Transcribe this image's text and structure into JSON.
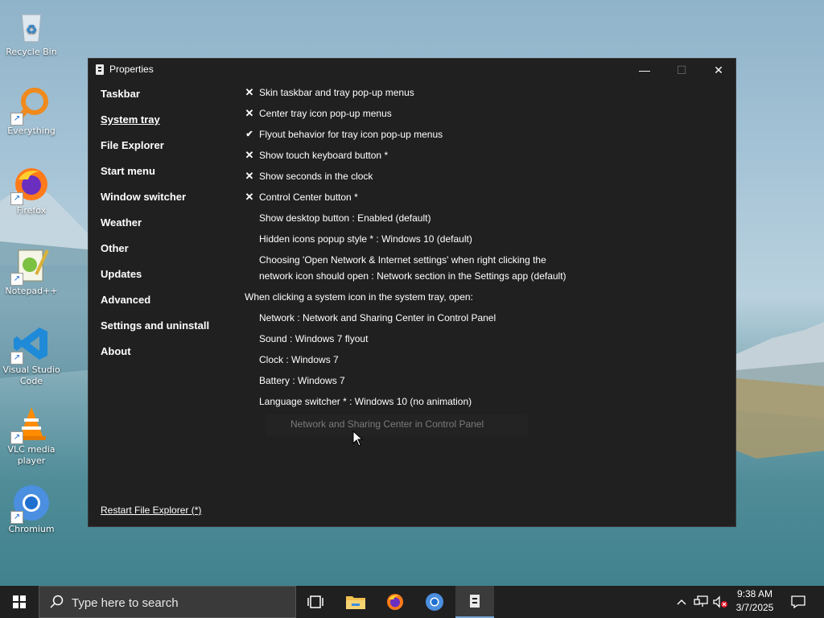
{
  "desktop": {
    "icons": [
      {
        "label": "Recycle Bin"
      },
      {
        "label": "Everything"
      },
      {
        "label": "Firefox"
      },
      {
        "label": "Notepad++"
      },
      {
        "label": "Visual Studio Code"
      },
      {
        "label": "VLC media player"
      },
      {
        "label": "Chromium"
      }
    ]
  },
  "window": {
    "title": "Properties",
    "controls": {
      "minimize": "—",
      "maximize": "☐",
      "close": "✕"
    },
    "nav": {
      "items": [
        {
          "label": "Taskbar"
        },
        {
          "label": "System tray"
        },
        {
          "label": "File Explorer"
        },
        {
          "label": "Start menu"
        },
        {
          "label": "Window switcher"
        },
        {
          "label": "Weather"
        },
        {
          "label": "Other"
        },
        {
          "label": "Updates"
        },
        {
          "label": "Advanced"
        },
        {
          "label": "Settings and uninstall"
        },
        {
          "label": "About"
        }
      ],
      "active": "System tray",
      "restart_label": "Restart File Explorer (*)"
    },
    "settings": [
      {
        "mark": "✕",
        "label": "Skin taskbar and tray pop-up menus"
      },
      {
        "mark": "✕",
        "label": "Center tray icon pop-up menus"
      },
      {
        "mark": "✔",
        "label": "Flyout behavior for tray icon pop-up menus"
      },
      {
        "mark": "✕",
        "label": "Show touch keyboard button *"
      },
      {
        "mark": "✕",
        "label": "Show seconds in the clock"
      },
      {
        "mark": "✕",
        "label": "Control Center button *"
      },
      {
        "mark": "",
        "label": "Show desktop button : Enabled (default)"
      },
      {
        "mark": "",
        "label": "Hidden icons popup style * : Windows 10 (default)"
      },
      {
        "mark": "",
        "label_line1": "Choosing 'Open Network & Internet settings' when right clicking the",
        "label_line2": "network icon should open : Network section in the Settings app (default)"
      },
      {
        "section": "When clicking a system icon in the system tray, open:"
      },
      {
        "mark": "",
        "label": "Network : Network and Sharing Center in Control Panel"
      },
      {
        "mark": "",
        "label": "Sound : Windows 7 flyout"
      },
      {
        "mark": "",
        "label": "Clock : Windows 7"
      },
      {
        "mark": "",
        "label": "Battery : Windows 7"
      },
      {
        "mark": "",
        "label": "Language switcher * : Windows 10 (no animation)"
      }
    ],
    "popup_item": "Network and Sharing Center in Control Panel"
  },
  "taskbar": {
    "search_placeholder": "Type here to search",
    "clock_time": "9:38 AM",
    "clock_date": "3/7/2025"
  },
  "colors": {
    "window_bg": "#202020",
    "taskbar_bg": "#202020",
    "text": "#ffffff",
    "disabled_text": "#7b7b7b",
    "active_indicator": "#7aa7d9"
  }
}
